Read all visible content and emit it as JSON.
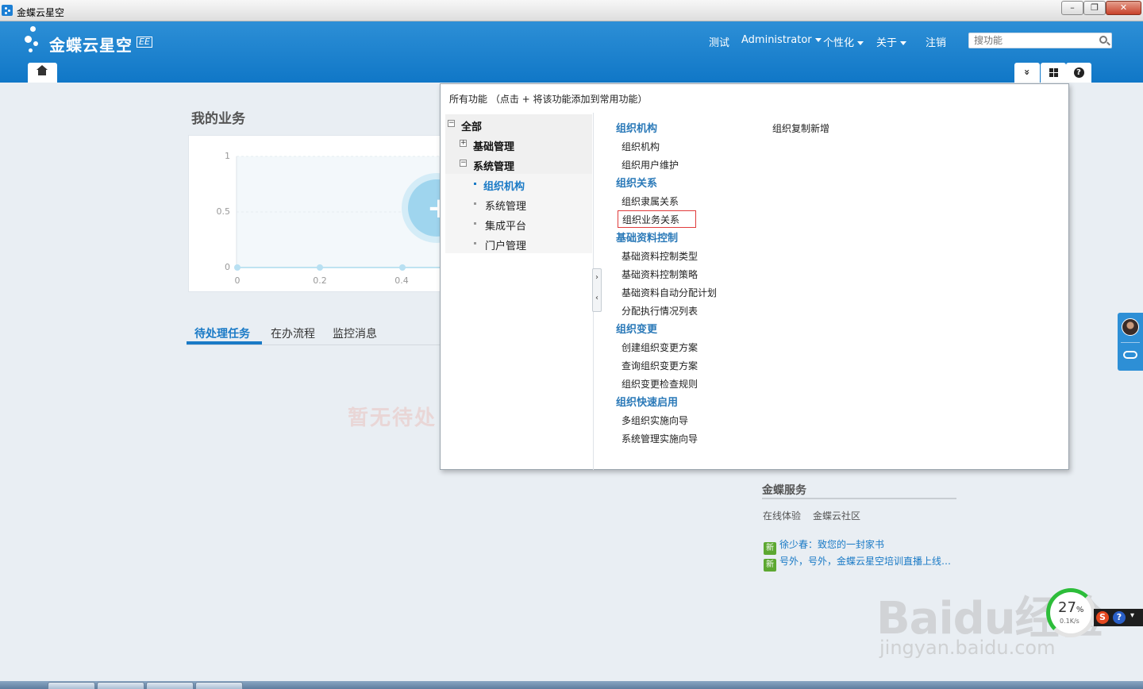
{
  "window": {
    "title": "金蝶云星空"
  },
  "header": {
    "logo_text": "金蝶云星空",
    "logo_edition": "EE",
    "nav": [
      {
        "label": "测试"
      },
      {
        "label": "Administrator"
      },
      {
        "label": "个性化"
      },
      {
        "label": "关于"
      },
      {
        "label": "注销"
      }
    ],
    "search_placeholder": "搜功能"
  },
  "my_business": {
    "title": "我的业务",
    "chart_data": {
      "type": "line",
      "x": [
        0,
        0.2,
        0.4
      ],
      "y": [
        0,
        0,
        0
      ],
      "ylim": [
        0,
        1
      ],
      "ytick_labels": [
        "1",
        "0.5",
        "0"
      ],
      "xtick_labels": [
        "0",
        "0.2",
        "0.4"
      ]
    }
  },
  "tasks": {
    "tabs": [
      "待处理任务",
      "在办流程",
      "监控消息"
    ],
    "empty_text": "暂无待处"
  },
  "popup": {
    "title": "所有功能 （点击 + 将该功能添加到常用功能）",
    "tree": {
      "root": "全部",
      "groups": [
        "基础管理",
        "系统管理"
      ],
      "children": [
        "组织机构",
        "系统管理",
        "集成平台",
        "门户管理"
      ]
    },
    "categories": [
      {
        "title": "组织机构",
        "items": [
          "组织机构",
          "组织用户维护"
        ]
      },
      {
        "title": "组织关系",
        "items": [
          "组织隶属关系",
          "组织业务关系"
        ]
      },
      {
        "title": "基础资料控制",
        "items": [
          "基础资料控制类型",
          "基础资料控制策略",
          "基础资料自动分配计划",
          "分配执行情况列表"
        ]
      },
      {
        "title": "组织变更",
        "items": [
          "创建组织变更方案",
          "查询组织变更方案",
          "组织变更检查规则"
        ]
      },
      {
        "title": "组织快速启用",
        "items": [
          "多组织实施向导",
          "系统管理实施向导"
        ]
      }
    ],
    "extra_item": "组织复制新增"
  },
  "service": {
    "title": "金蝶服务",
    "links": [
      "在线体验",
      "金蝶云社区"
    ],
    "news_badge": "新",
    "news": [
      "徐少春：致您的一封家书",
      "号外，号外，金蝶云星空培训直播上线…"
    ]
  },
  "speed_meter": {
    "percent": "27",
    "percent_unit": "%",
    "rate": "0.1K/s"
  },
  "watermark": {
    "brand": "Baidu经验",
    "site": "jingyan.baidu.com"
  },
  "colors": {
    "header_blue": "#1a7ac6",
    "category_blue": "#2a79b8",
    "highlight_red": "#e03b3b",
    "badge_green": "#5da831"
  }
}
